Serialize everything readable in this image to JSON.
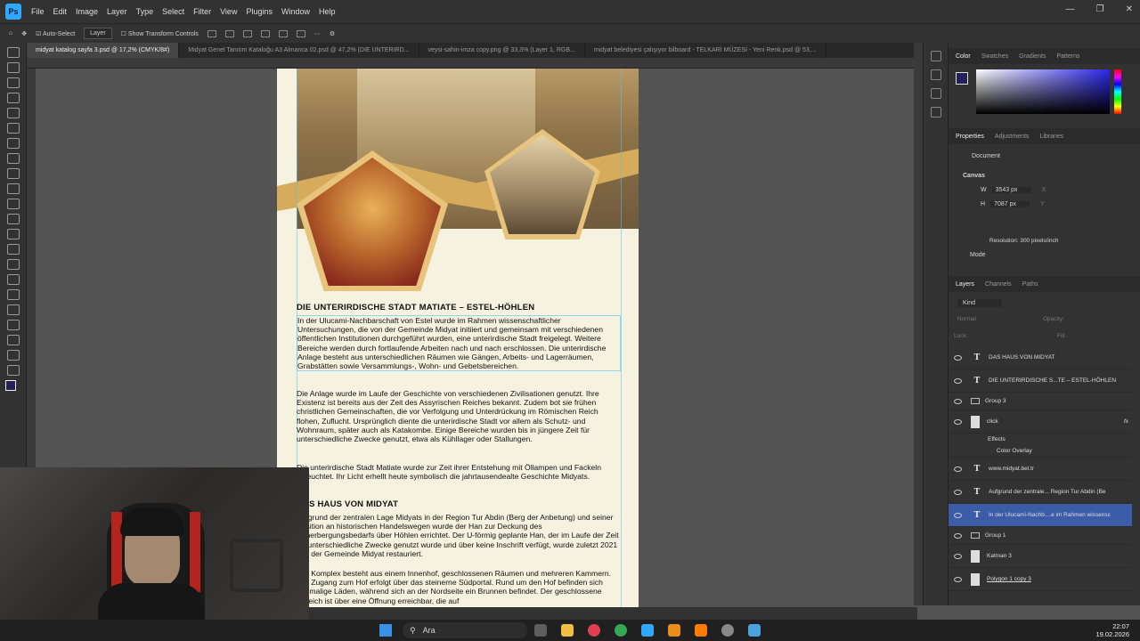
{
  "menubar": {
    "logo": "Ps",
    "items": [
      "File",
      "Edit",
      "Image",
      "Layer",
      "Type",
      "Select",
      "Filter",
      "View",
      "Plugins",
      "Window",
      "Help"
    ]
  },
  "options": {
    "auto_select": "Auto-Select",
    "layer_select": "Layer",
    "transform_controls": "Show Transform Controls"
  },
  "tabs": [
    "midyat katalog sayfa 3.psd @ 17,2% (CMYK/8#)",
    "Midyat Genel Tanıtım Kataloğu A3 Almanca 02.psd @ 47,2% (DIE UNTERIRD...",
    "veysi-sahin-imza copy.png @ 33,3% (Layer 1, RGB...",
    "midyat belediyesi çalışıyor bilboard - TELKARİ MÜZESİ - Yeni Renk.psd @ 53,..."
  ],
  "document": {
    "heading1": "DIE UNTERIRDISCHE STADT MATIATE – ESTEL-HÖHLEN",
    "para1": "In der Ulucami-Nachbarschaft von Estel wurde im Rahmen wissenschaftlicher Untersuchungen, die von der Gemeinde Midyat initiiert und gemeinsam mit verschiedenen öffentlichen Institutionen durchgeführt wurden, eine unterirdische Stadt freigelegt. Weitere Bereiche werden durch fortlaufende Arbeiten nach und nach erschlossen. Die unterirdische Anlage besteht aus unterschiedlichen Räumen wie Gängen, Arbeits- und Lagerräumen, Grabstätten sowie Versammlungs-, Wohn- und Gebetsbereichen.",
    "para2": "Die Anlage wurde im Laufe der Geschichte von verschiedenen Zivilisationen genutzt. Ihre Existenz ist bereits aus der Zeit des Assyrischen Reiches bekannt. Zudem bot sie frühen christlichen Gemeinschaften, die vor Verfolgung und Unterdrückung im Römischen Reich flohen, Zuflucht. Ursprünglich diente die unterirdische Stadt vor allem als Schutz- und Wohnraum, später auch als Katakombe. Einige Bereiche wurden bis in jüngere Zeit für unterschiedliche Zwecke genutzt, etwa als Kühllager oder Stallungen.",
    "para3": "Die unterirdische Stadt Matiate wurde zur Zeit ihrer Entstehung mit Öllampen und Fackeln beleuchtet. Ihr Licht erhellt heute symbolisch die jahrtausendealte Geschichte Midyats.",
    "heading2": "DAS HAUS VON MIDYAT",
    "para4": "Aufgrund der zentralen Lage Midyats in der Region Tur Abdin (Berg der Anbetung) und seiner Position an historischen Handelswegen wurde der Han zur Deckung des Beherbergungsbedarfs über Höhlen errichtet. Der U-förmig geplante Han, der im Laufe der Zeit für unterschiedliche Zwecke genutzt wurde und über keine Inschrift verfügt, wurde zuletzt 2021 von der Gemeinde Midyat restauriert.",
    "para5": "Der Komplex besteht aus einem Innenhof, geschlossenen Räumen und mehreren Kammern. Der Zugang zum Hof erfolgt über das steinerne Südportal. Rund um den Hof befinden sich ehemalige Läden, während sich an der Nordseite ein Brunnen befindet. Der geschlossene Bereich ist über eine Öffnung erreichbar, die auf"
  },
  "color_panel": {
    "tabs": [
      "Color",
      "Swatches",
      "Gradients",
      "Patterns"
    ],
    "fg_color": "#23205a"
  },
  "properties": {
    "tabs": [
      "Properties",
      "Adjustments",
      "Libraries"
    ],
    "doc_label": "Document",
    "canvas_label": "Canvas",
    "w_label": "W",
    "w_value": "3543 px",
    "h_label": "H",
    "h_value": "7087 px",
    "x_label": "X",
    "y_label": "Y",
    "resolution": "Resolution: 300 pixels/inch",
    "mode": "Mode"
  },
  "layers_panel": {
    "tabs": [
      "Layers",
      "Channels",
      "Paths"
    ],
    "kind": "Kind",
    "blend": "Normal",
    "opacity_label": "Opacity:",
    "lock_label": "Lock:",
    "fill_label": "Fill:",
    "layers": [
      {
        "type": "text",
        "name": "DAS HAUS VON MIDYAT",
        "selected": false
      },
      {
        "type": "text",
        "name": "DIE UNTERIRDISCHE S...TE – ESTEL-HÖHLEN",
        "selected": false
      },
      {
        "type": "group",
        "name": "Group 3",
        "selected": false
      },
      {
        "type": "image",
        "name": "click",
        "selected": false,
        "fx": "fx"
      },
      {
        "type": "effects",
        "name": "Effects",
        "selected": false
      },
      {
        "type": "effect",
        "name": "Color Overlay",
        "selected": false
      },
      {
        "type": "text",
        "name": "www.midyat.bel.tr",
        "selected": false
      },
      {
        "type": "text",
        "name": "Aufgrund der zentrale... Region Tur Abdin (Be",
        "selected": false
      },
      {
        "type": "text",
        "name": "In der Ulucami-Nachb....e im Rahmen wissensc",
        "selected": true
      },
      {
        "type": "group",
        "name": "Group 1",
        "selected": false
      },
      {
        "type": "image",
        "name": "Katman 3",
        "selected": false
      },
      {
        "type": "image",
        "name": "Polygon 1 copy 3",
        "selected": false
      }
    ]
  },
  "taskbar": {
    "search": "Ara",
    "time": "22:07",
    "date": "19.02.2026"
  }
}
